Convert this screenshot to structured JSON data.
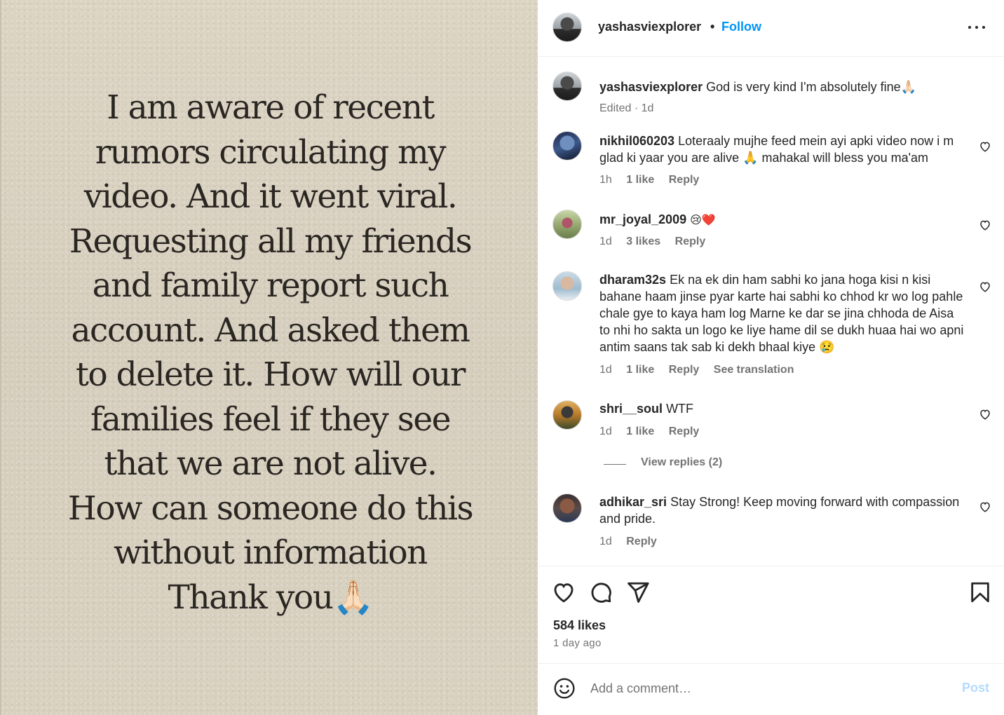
{
  "post": {
    "image_text_lines": [
      "I am aware of recent",
      "rumors circulating my",
      "video. And it went viral.",
      "Requesting all my friends",
      "and family report such",
      "account. And asked them",
      "to delete it. How will our",
      "families feel if they see",
      "that we are not alive.",
      "How can someone do this",
      "without information",
      "Thank you🙏🏻"
    ]
  },
  "header": {
    "username": "yashasviexplorer",
    "separator": "•",
    "follow_label": "Follow"
  },
  "caption": {
    "username": "yashasviexplorer",
    "text": "God is very kind I'm absolutely fine🙏🏻",
    "meta": "Edited · 1d"
  },
  "comments": [
    {
      "username": "nikhil060203",
      "text": "Loteraaly mujhe feed mein ayi apki video now i m glad ki yaar you are alive 🙏 mahakal will bless you ma'am",
      "time": "1h",
      "likes": "1 like",
      "reply": "Reply"
    },
    {
      "username": "mr_joyal_2009",
      "text": "😢❤️",
      "time": "1d",
      "likes": "3 likes",
      "reply": "Reply"
    },
    {
      "username": "dharam32s",
      "text": "Ek na ek din ham sabhi ko jana hoga kisi n kisi bahane haam jinse pyar karte hai sabhi ko chhod kr wo log pahle chale gye to kaya ham log Marne ke dar se jina chhoda de Aisa to nhi ho sakta un logo ke liye hame dil se dukh huaa hai wo apni antim saans tak sab ki dekh bhaal kiye 😢",
      "time": "1d",
      "likes": "1 like",
      "reply": "Reply",
      "translation": "See translation"
    },
    {
      "username": "shri__soul",
      "text": "WTF",
      "time": "1d",
      "likes": "1 like",
      "reply": "Reply",
      "view_replies": "View replies (2)"
    },
    {
      "username": "adhikar_sri",
      "text": "Stay Strong! Keep moving forward with compassion and pride.",
      "time": "1d",
      "reply": "Reply"
    }
  ],
  "actions": {
    "likes": "584 likes",
    "time_ago": "1 day ago"
  },
  "add_comment": {
    "placeholder": "Add a comment…",
    "post_label": "Post"
  },
  "colors": {
    "accent": "#0095f6",
    "post_disabled": "#b3dbff",
    "meta_gray": "#737373",
    "image_bg": "#d9d1c0"
  },
  "icons": [
    "more-icon",
    "heart-icon",
    "comment-icon",
    "share-icon",
    "bookmark-icon",
    "emoji-icon"
  ]
}
